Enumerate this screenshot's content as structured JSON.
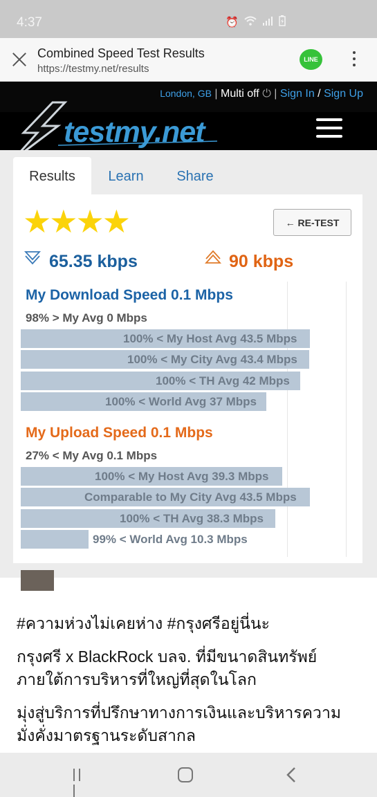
{
  "status_bar": {
    "time": "4:37",
    "icons": [
      "alarm-icon",
      "wifi-icon",
      "signal-icon",
      "battery-icon"
    ]
  },
  "tab_header": {
    "title": "Combined Speed Test Results",
    "url": "https://testmy.net/results",
    "line_label": "LINE"
  },
  "site_header": {
    "location": "London, GB",
    "sep1": "|",
    "multi": "Multi off",
    "sep2": "|",
    "sign_in": "Sign In",
    "slash": "/",
    "sign_up": "Sign Up",
    "logo": "testmy.net"
  },
  "tabs": [
    {
      "label": "Results",
      "active": true
    },
    {
      "label": "Learn",
      "active": false
    },
    {
      "label": "Share",
      "active": false
    }
  ],
  "results": {
    "stars": "★★★★",
    "star_count": 4,
    "retest_label": "← RE-TEST",
    "download_speed": "65.35 kbps",
    "upload_speed": "90 kbps",
    "download": {
      "heading": "My Download Speed 0.1 Mbps",
      "avg": "98% > My Avg 0 Mbps",
      "bars": [
        {
          "label": "100% < My Host Avg 43.5 Mbps",
          "value": 43.5
        },
        {
          "label": "100% < My City Avg 43.4 Mbps",
          "value": 43.4
        },
        {
          "label": "100% < TH Avg 42 Mbps",
          "value": 42
        },
        {
          "label": "100% < World Avg 37 Mbps",
          "value": 37
        }
      ]
    },
    "upload": {
      "heading": "My Upload Speed 0.1 Mbps",
      "avg": "27% < My Avg 0.1 Mbps",
      "bars": [
        {
          "label": "100% < My Host Avg 39.3 Mbps",
          "value": 39.3
        },
        {
          "label": "Comparable to My City Avg 43.5 Mbps",
          "value": 43.5
        },
        {
          "label": "100% < TH Avg 38.3 Mbps",
          "value": 38.3
        },
        {
          "label": "99% < World Avg 10.3 Mbps",
          "value": 10.3
        }
      ]
    }
  },
  "post": {
    "lines": [
      "#ความห่วงไม่เคยห่าง #กรุงศรีอยู่นี่นะ",
      "กรุงศรี x BlackRock บลจ. ที่มีขนาดสินทรัพย์",
      "ภายใต้การบริหารที่ใหญ่ที่สุดในโลก",
      "มุ่งสู่บริการที่ปรึกษาทางการเงินและบริหารความ",
      "มั่งคั่งมาตรฐานระดับสากล"
    ]
  },
  "nav_bar": {
    "icons": [
      "recent-apps-icon",
      "home-icon",
      "back-icon"
    ]
  }
}
